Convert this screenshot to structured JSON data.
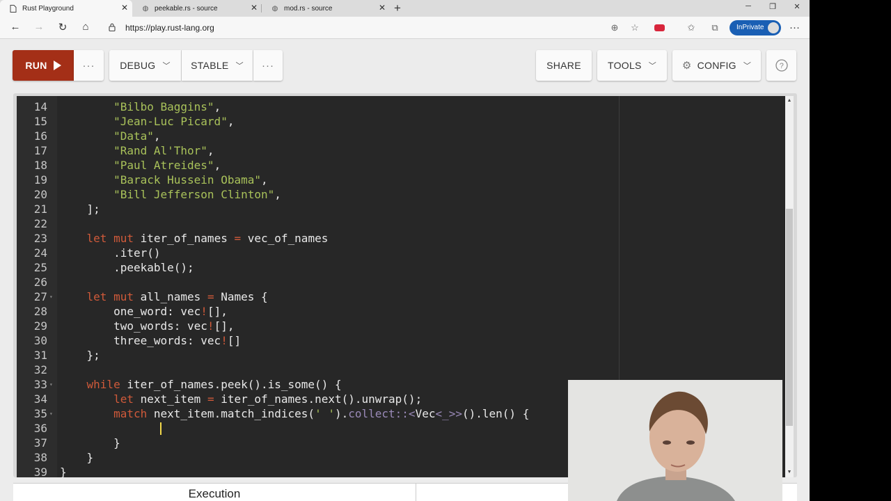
{
  "browser": {
    "tabs": [
      {
        "title": "Rust Playground",
        "icon": "page-icon",
        "active": true
      },
      {
        "title": "peekable.rs - source",
        "icon": "globe-icon",
        "active": false
      },
      {
        "title": "mod.rs - source",
        "icon": "globe-icon",
        "active": false
      }
    ],
    "url": "https://play.rust-lang.org",
    "inprivate_label": "InPrivate"
  },
  "toolbar": {
    "run_label": "RUN",
    "mode_label": "DEBUG",
    "channel_label": "STABLE",
    "share_label": "SHARE",
    "tools_label": "TOOLS",
    "config_label": "CONFIG",
    "help_label": "?",
    "more_label": "···"
  },
  "editor": {
    "lines": [
      {
        "n": "14",
        "fold": "",
        "tokens": [
          [
            "s",
            "        \"Bilbo Baggins\""
          ],
          [
            "p",
            ","
          ]
        ]
      },
      {
        "n": "15",
        "fold": "",
        "tokens": [
          [
            "s",
            "        \"Jean-Luc Picard\""
          ],
          [
            "p",
            ","
          ]
        ]
      },
      {
        "n": "16",
        "fold": "",
        "tokens": [
          [
            "s",
            "        \"Data\""
          ],
          [
            "p",
            ","
          ]
        ]
      },
      {
        "n": "17",
        "fold": "",
        "tokens": [
          [
            "s",
            "        \"Rand Al'Thor\""
          ],
          [
            "p",
            ","
          ]
        ]
      },
      {
        "n": "18",
        "fold": "",
        "tokens": [
          [
            "s",
            "        \"Paul Atreides\""
          ],
          [
            "p",
            ","
          ]
        ]
      },
      {
        "n": "19",
        "fold": "",
        "tokens": [
          [
            "s",
            "        \"Barack Hussein Obama\""
          ],
          [
            "p",
            ","
          ]
        ]
      },
      {
        "n": "20",
        "fold": "",
        "tokens": [
          [
            "s",
            "        \"Bill Jefferson Clinton\""
          ],
          [
            "p",
            ","
          ]
        ]
      },
      {
        "n": "21",
        "fold": "",
        "tokens": [
          [
            "p",
            "    ];"
          ]
        ]
      },
      {
        "n": "22",
        "fold": "",
        "tokens": []
      },
      {
        "n": "23",
        "fold": "",
        "tokens": [
          [
            "p",
            "    "
          ],
          [
            "k",
            "let mut"
          ],
          [
            "p",
            " iter_of_names "
          ],
          [
            "k",
            "="
          ],
          [
            "p",
            " vec_of_names"
          ]
        ]
      },
      {
        "n": "24",
        "fold": "",
        "tokens": [
          [
            "p",
            "        .iter()"
          ]
        ]
      },
      {
        "n": "25",
        "fold": "",
        "tokens": [
          [
            "p",
            "        .peekable();"
          ]
        ]
      },
      {
        "n": "26",
        "fold": "",
        "tokens": []
      },
      {
        "n": "27",
        "fold": "▾",
        "tokens": [
          [
            "p",
            "    "
          ],
          [
            "k",
            "let mut"
          ],
          [
            "p",
            " all_names "
          ],
          [
            "k",
            "="
          ],
          [
            "p",
            " Names {"
          ]
        ]
      },
      {
        "n": "28",
        "fold": "",
        "tokens": [
          [
            "p",
            "        one_word: vec"
          ],
          [
            "m",
            "!"
          ],
          [
            "p",
            "[],"
          ]
        ]
      },
      {
        "n": "29",
        "fold": "",
        "tokens": [
          [
            "p",
            "        two_words: vec"
          ],
          [
            "m",
            "!"
          ],
          [
            "p",
            "[],"
          ]
        ]
      },
      {
        "n": "30",
        "fold": "",
        "tokens": [
          [
            "p",
            "        three_words: vec"
          ],
          [
            "m",
            "!"
          ],
          [
            "p",
            "[]"
          ]
        ]
      },
      {
        "n": "31",
        "fold": "",
        "tokens": [
          [
            "p",
            "    };"
          ]
        ]
      },
      {
        "n": "32",
        "fold": "",
        "tokens": []
      },
      {
        "n": "33",
        "fold": "▾",
        "tokens": [
          [
            "p",
            "    "
          ],
          [
            "k",
            "while"
          ],
          [
            "p",
            " iter_of_names.peek().is_some() {"
          ]
        ]
      },
      {
        "n": "34",
        "fold": "",
        "tokens": [
          [
            "p",
            "        "
          ],
          [
            "k",
            "let"
          ],
          [
            "p",
            " next_item "
          ],
          [
            "k",
            "="
          ],
          [
            "p",
            " iter_of_names.next().unwrap();"
          ]
        ]
      },
      {
        "n": "35",
        "fold": "▾",
        "tokens": [
          [
            "p",
            "        "
          ],
          [
            "k",
            "match"
          ],
          [
            "p",
            " next_item.match_indices("
          ],
          [
            "s",
            "' '"
          ],
          [
            "p",
            ")."
          ],
          [
            "t",
            "collect::<"
          ],
          [
            "p",
            "Vec"
          ],
          [
            "t",
            "<_>>"
          ],
          [
            "p",
            "().len() {"
          ]
        ]
      },
      {
        "n": "36",
        "fold": "",
        "tokens": []
      },
      {
        "n": "37",
        "fold": "",
        "tokens": [
          [
            "p",
            "        }"
          ]
        ]
      },
      {
        "n": "38",
        "fold": "",
        "tokens": [
          [
            "p",
            "    }"
          ]
        ]
      },
      {
        "n": "39",
        "fold": "",
        "tokens": [
          [
            "p",
            "}"
          ]
        ]
      }
    ]
  },
  "output": {
    "execution_label": "Execution"
  }
}
